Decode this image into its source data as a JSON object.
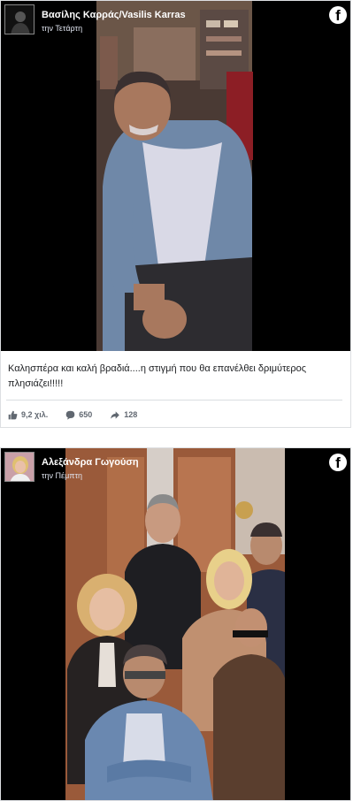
{
  "posts": [
    {
      "author": "Βασίλης Καρράς/Vasilis Karras",
      "time": "την Τετάρτη",
      "caption": "Καλησπέρα και καλή βραδιά....η στιγμή που θα επανέλθει δριμύτερος πλησιάζει!!!!!",
      "likes": "9,2 χιλ.",
      "comments": "650",
      "shares": "128"
    },
    {
      "author": "Αλεξάνδρα Γωγούση",
      "time": "την Πέμπτη"
    }
  ],
  "icons": {
    "brand": "facebook-logo",
    "like": "thumbs-up-icon",
    "comment": "comment-icon",
    "share": "share-arrow-icon",
    "facebook_glyph": "f"
  },
  "colors": {
    "background": "#ffffff",
    "text": "#1c1e21",
    "muted": "#606770",
    "photo_background": "#000000"
  }
}
